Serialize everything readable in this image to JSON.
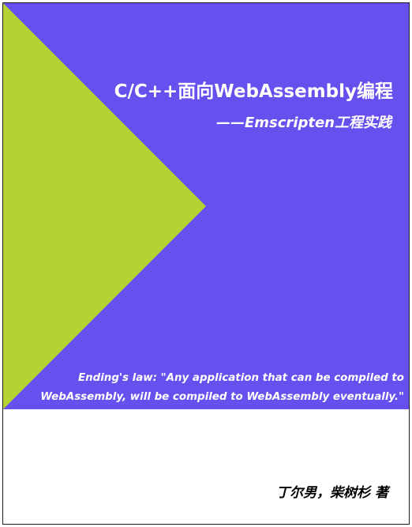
{
  "cover": {
    "title": "C/C++面向WebAssembly编程",
    "subtitle": "——Emscripten工程实践",
    "quote_line1": "Ending's law: \"Any application that can be compiled to",
    "quote_line2": "WebAssembly, will be compiled to WebAssembly eventually.\"",
    "author": "丁尔男，柴树杉 著"
  },
  "colors": {
    "band": "#6650ee",
    "triangle": "#b5d234",
    "text_on_band": "#ffffff",
    "background": "#ffffff",
    "author_text": "#000000"
  }
}
